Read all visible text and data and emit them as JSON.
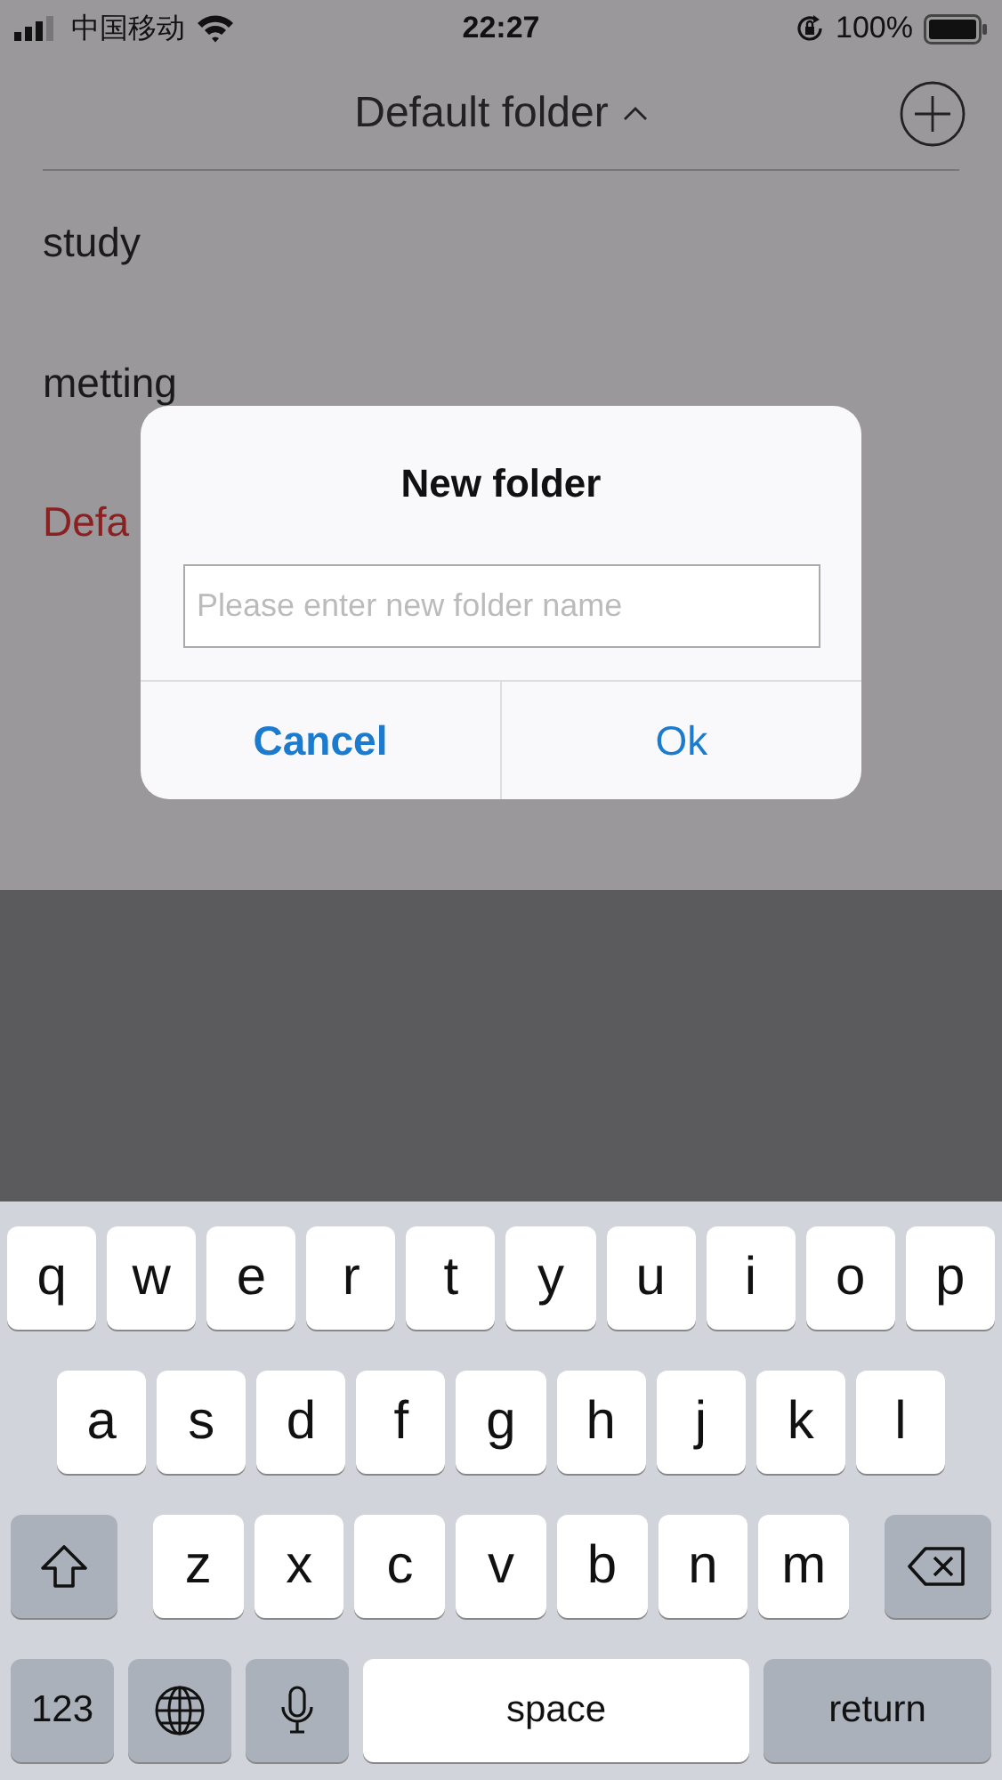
{
  "status_bar": {
    "carrier": "中国移动",
    "time": "22:27",
    "battery": "100%"
  },
  "header": {
    "title": "Default folder",
    "expanded": true
  },
  "folders": [
    {
      "name": "study",
      "selected": false
    },
    {
      "name": "metting",
      "selected": false
    },
    {
      "name": "Defa",
      "selected": true
    }
  ],
  "dialog": {
    "title": "New folder",
    "placeholder": "Please enter new folder name",
    "buttons": [
      {
        "label": "Cancel",
        "kind": "cancel"
      },
      {
        "label": "Ok",
        "kind": "ok"
      }
    ]
  },
  "keyboard": {
    "key_rows": [
      {
        "keys": [
          {
            "kind": "letter",
            "label": "q"
          },
          {
            "kind": "letter",
            "label": "w"
          },
          {
            "kind": "letter",
            "label": "e"
          },
          {
            "kind": "letter",
            "label": "r"
          },
          {
            "kind": "letter",
            "label": "t"
          },
          {
            "kind": "letter",
            "label": "y"
          },
          {
            "kind": "letter",
            "label": "u"
          },
          {
            "kind": "letter",
            "label": "i"
          },
          {
            "kind": "letter",
            "label": "o"
          },
          {
            "kind": "letter",
            "label": "p"
          }
        ]
      },
      {
        "keys": [
          {
            "kind": "letter",
            "label": "a"
          },
          {
            "kind": "letter",
            "label": "s"
          },
          {
            "kind": "letter",
            "label": "d"
          },
          {
            "kind": "letter",
            "label": "f"
          },
          {
            "kind": "letter",
            "label": "g"
          },
          {
            "kind": "letter",
            "label": "h"
          },
          {
            "kind": "letter",
            "label": "j"
          },
          {
            "kind": "letter",
            "label": "k"
          },
          {
            "kind": "letter",
            "label": "l"
          }
        ]
      },
      {
        "keys": [
          {
            "kind": "shift"
          },
          {
            "kind": "letter",
            "label": "z"
          },
          {
            "kind": "letter",
            "label": "x"
          },
          {
            "kind": "letter",
            "label": "c"
          },
          {
            "kind": "letter",
            "label": "v"
          },
          {
            "kind": "letter",
            "label": "b"
          },
          {
            "kind": "letter",
            "label": "n"
          },
          {
            "kind": "letter",
            "label": "m"
          },
          {
            "kind": "delete"
          }
        ]
      },
      {
        "keys": [
          {
            "kind": "numbers",
            "label": "123"
          },
          {
            "kind": "globe"
          },
          {
            "kind": "mic"
          },
          {
            "kind": "space",
            "label": "space"
          },
          {
            "kind": "return",
            "label": "return"
          }
        ]
      }
    ]
  }
}
